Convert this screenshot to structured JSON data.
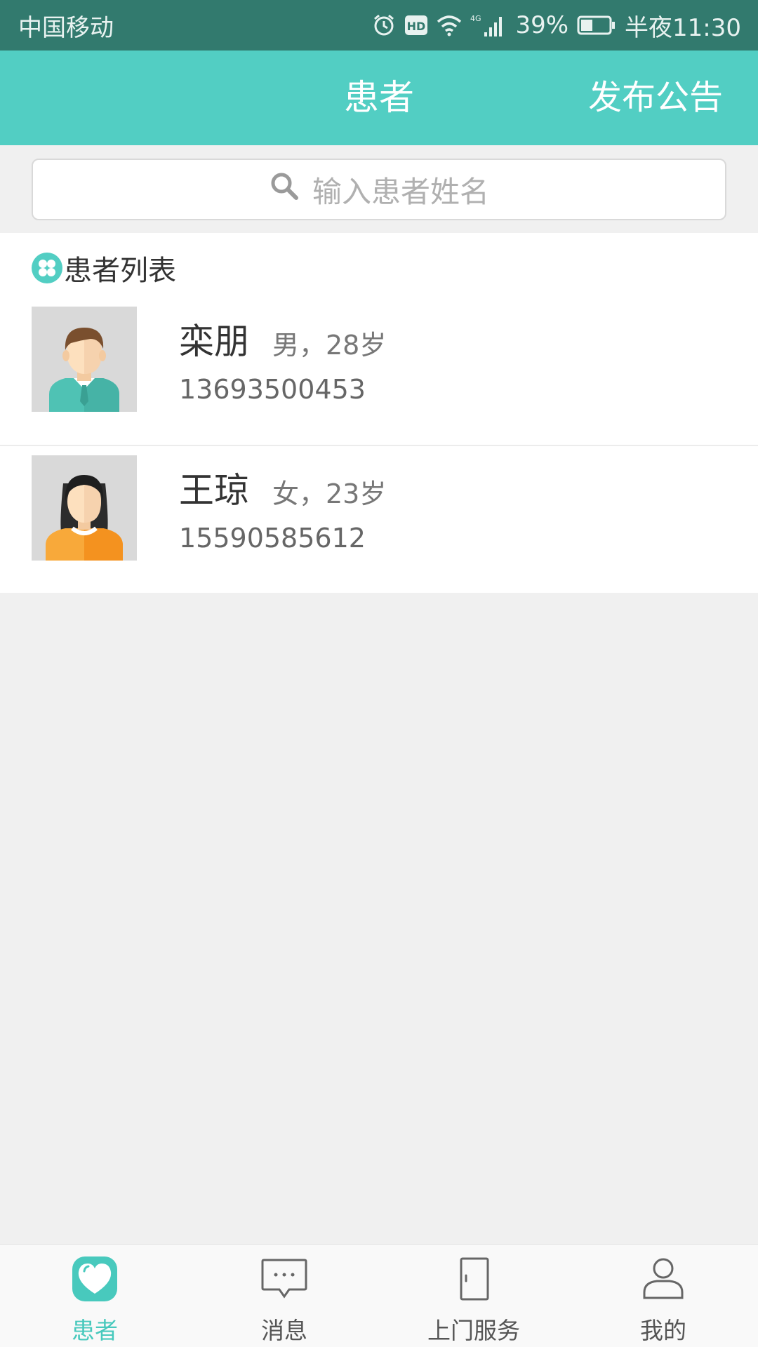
{
  "status_bar": {
    "carrier": "中国移动",
    "battery_percent": "39%",
    "time": "半夜11:30",
    "network_label": "4G",
    "hd_label": "HD"
  },
  "header": {
    "title": "患者",
    "action_label": "发布公告",
    "background_color": "#52cec3"
  },
  "search": {
    "placeholder": "输入患者姓名"
  },
  "patient_list": {
    "title": "患者列表",
    "patients": [
      {
        "name": "栾朋",
        "info": "男，28岁",
        "phone": "13693500453",
        "avatar": "male-avatar"
      },
      {
        "name": "王琼",
        "info": "女，23岁",
        "phone": "15590585612",
        "avatar": "female-avatar"
      }
    ]
  },
  "tabs": [
    {
      "label": "患者",
      "icon": "heart-icon",
      "active": true
    },
    {
      "label": "消息",
      "icon": "chat-bubble-icon",
      "active": false
    },
    {
      "label": "上门服务",
      "icon": "door-icon",
      "active": false
    },
    {
      "label": "我的",
      "icon": "person-icon",
      "active": false
    }
  ],
  "colors": {
    "accent": "#52cec3",
    "status_bar": "#327a6e",
    "active_tab": "#48c9bd"
  }
}
